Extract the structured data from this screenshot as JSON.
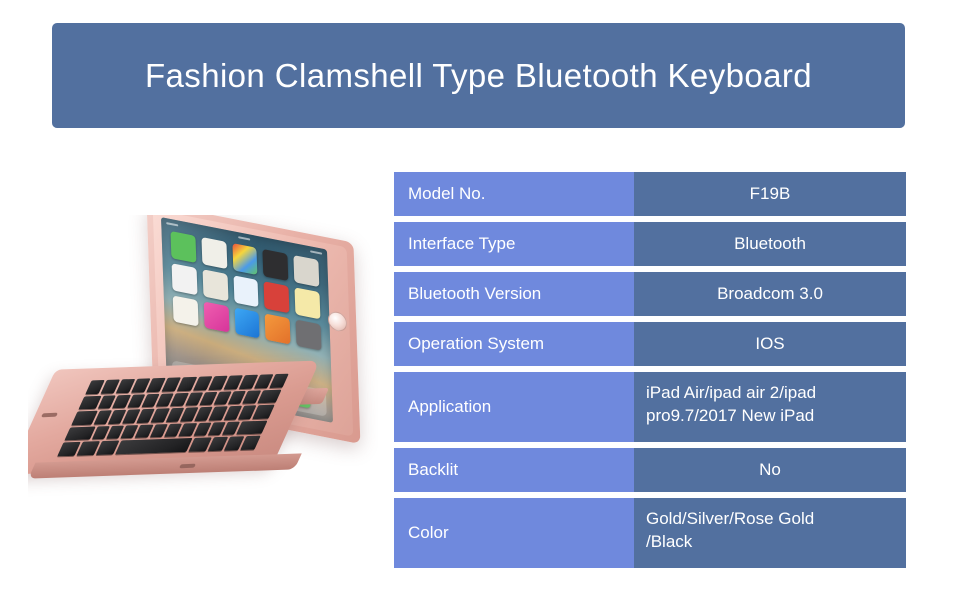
{
  "banner": {
    "title": "Fashion Clamshell Type Bluetooth Keyboard",
    "background_color": "#52709f",
    "text_color": "#ffffff"
  },
  "product_image": {
    "alt": "Rose gold clamshell Bluetooth keyboard case with iPad mounted in the lid, shown open at an angle",
    "body_color": "#e3a99f",
    "key_color": "#232325"
  },
  "colors": {
    "label_cell": "#6f89dd",
    "value_cell": "#52709f",
    "page_background": "#ffffff",
    "text": "#ffffff"
  },
  "spec_table": {
    "rows": [
      {
        "label": "Model No.",
        "value": "F19B",
        "height": "normal",
        "align": "center"
      },
      {
        "label": "Interface Type",
        "value": "Bluetooth",
        "height": "normal",
        "align": "center"
      },
      {
        "label": "Bluetooth Version",
        "value": "Broadcom 3.0",
        "height": "normal",
        "align": "center"
      },
      {
        "label": "Operation System",
        "value": "IOS",
        "height": "normal",
        "align": "center"
      },
      {
        "label": "Application",
        "value": "iPad Air/ipad air 2/ipad pro9.7/2017 New iPad",
        "value_line1": "iPad Air/ipad air 2/ipad",
        "value_line2": "pro9.7/2017 New iPad",
        "height": "tall",
        "align": "left"
      },
      {
        "label": "Backlit",
        "value": "No",
        "height": "normal",
        "align": "center"
      },
      {
        "label": "Color",
        "value": "Gold/Silver/Rose Gold /Black",
        "value_line1": "Gold/Silver/Rose Gold",
        "value_line2": "/Black",
        "height": "tall",
        "align": "left"
      }
    ]
  }
}
